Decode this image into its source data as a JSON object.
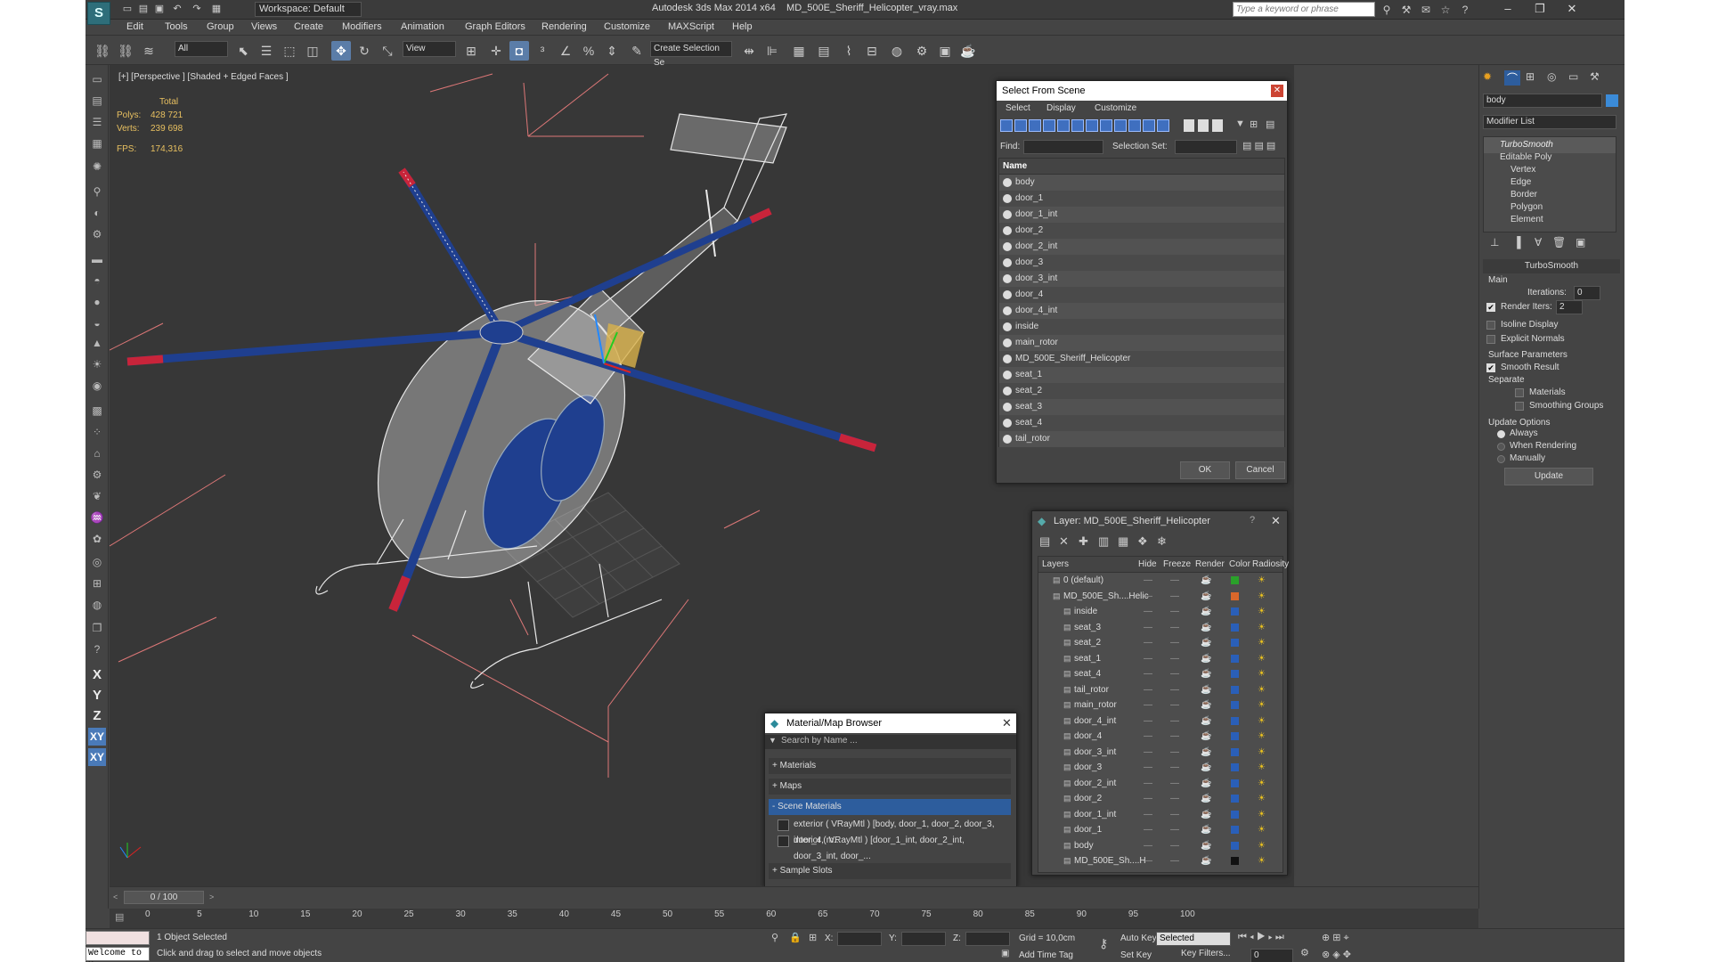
{
  "titlebar": {
    "workspace": "Workspace: Default",
    "app_title": "Autodesk 3ds Max  2014 x64",
    "file_title": "MD_500E_Sheriff_Helicopter_vray.max",
    "search_placeholder": "Type a keyword or phrase"
  },
  "menu": [
    "Edit",
    "Tools",
    "Group",
    "Views",
    "Create",
    "Modifiers",
    "Animation",
    "Graph Editors",
    "Rendering",
    "Customize",
    "MAXScript",
    "Help"
  ],
  "toolbar": {
    "selection_filter": "All",
    "ref_coord": "View",
    "named_selection": "Create Selection Se"
  },
  "viewport": {
    "label": "[+] [Perspective ] [Shaded + Edged Faces ]",
    "stats_total": "Total",
    "polys_label": "Polys:",
    "polys_value": "428 721",
    "verts_label": "Verts:",
    "verts_value": "239 698",
    "fps_label": "FPS:",
    "fps_value": "174,316"
  },
  "select_from_scene": {
    "title": "Select From Scene",
    "menu": [
      "Select",
      "Display",
      "Customize"
    ],
    "find_label": "Find:",
    "selection_set_label": "Selection Set:",
    "column_name": "Name",
    "items": [
      "body",
      "door_1",
      "door_1_int",
      "door_2",
      "door_2_int",
      "door_3",
      "door_3_int",
      "door_4",
      "door_4_int",
      "inside",
      "main_rotor",
      "MD_500E_Sheriff_Helicopter",
      "seat_1",
      "seat_2",
      "seat_3",
      "seat_4",
      "tail_rotor"
    ],
    "ok": "OK",
    "cancel": "Cancel"
  },
  "layer_dialog": {
    "title": "Layer: MD_500E_Sheriff_Helicopter",
    "columns": [
      "Layers",
      "Hide",
      "Freeze",
      "Render",
      "Color",
      "Radiosity"
    ],
    "layers": [
      {
        "name": "0 (default)",
        "indent": 0,
        "color": "#2aa12a"
      },
      {
        "name": "MD_500E_Sh....Helic",
        "indent": 0,
        "color": "#d9672a"
      },
      {
        "name": "inside",
        "indent": 1,
        "color": "#2a5fb8"
      },
      {
        "name": "seat_3",
        "indent": 1,
        "color": "#2a5fb8"
      },
      {
        "name": "seat_2",
        "indent": 1,
        "color": "#2a5fb8"
      },
      {
        "name": "seat_1",
        "indent": 1,
        "color": "#2a5fb8"
      },
      {
        "name": "seat_4",
        "indent": 1,
        "color": "#2a5fb8"
      },
      {
        "name": "tail_rotor",
        "indent": 1,
        "color": "#2a5fb8"
      },
      {
        "name": "main_rotor",
        "indent": 1,
        "color": "#2a5fb8"
      },
      {
        "name": "door_4_int",
        "indent": 1,
        "color": "#2a5fb8"
      },
      {
        "name": "door_4",
        "indent": 1,
        "color": "#2a5fb8"
      },
      {
        "name": "door_3_int",
        "indent": 1,
        "color": "#2a5fb8"
      },
      {
        "name": "door_3",
        "indent": 1,
        "color": "#2a5fb8"
      },
      {
        "name": "door_2_int",
        "indent": 1,
        "color": "#2a5fb8"
      },
      {
        "name": "door_2",
        "indent": 1,
        "color": "#2a5fb8"
      },
      {
        "name": "door_1_int",
        "indent": 1,
        "color": "#2a5fb8"
      },
      {
        "name": "door_1",
        "indent": 1,
        "color": "#2a5fb8"
      },
      {
        "name": "body",
        "indent": 1,
        "color": "#2a5fb8"
      },
      {
        "name": "MD_500E_Sh....H",
        "indent": 1,
        "color": "#111111"
      }
    ]
  },
  "material_browser": {
    "title": "Material/Map Browser",
    "search_placeholder": "Search by Name ...",
    "sections": [
      "+ Materials",
      "+ Maps",
      "- Scene Materials",
      "+ Sample Slots"
    ],
    "scene_materials": [
      "exterior  ( VRayMtl ) [body, door_1, door_2, door_3, door_4, m...",
      "interior  ( VRayMtl ) [door_1_int, door_2_int, door_3_int, door_..."
    ]
  },
  "command_panel": {
    "object_name": "body",
    "modifier_list": "Modifier List",
    "stack": [
      "TurboSmooth",
      "Editable Poly",
      "Vertex",
      "Edge",
      "Border",
      "Polygon",
      "Element"
    ],
    "rollout_title": "TurboSmooth",
    "main_label": "Main",
    "iterations_label": "Iterations:",
    "iterations_value": "0",
    "render_iters_label": "Render Iters:",
    "render_iters_value": "2",
    "isoline": "Isoline Display",
    "explicit": "Explicit Normals",
    "surface_params": "Surface Parameters",
    "smooth_result": "Smooth Result",
    "separate": "Separate",
    "materials": "Materials",
    "smoothing_groups": "Smoothing Groups",
    "update_options": "Update Options",
    "always": "Always",
    "when_rendering": "When Rendering",
    "manually": "Manually",
    "update_btn": "Update"
  },
  "timeline": {
    "frame": "0 / 100",
    "ticks": [
      "0",
      "5",
      "10",
      "15",
      "20",
      "25",
      "30",
      "35",
      "40",
      "45",
      "50",
      "55",
      "60",
      "65",
      "70",
      "75",
      "80",
      "85",
      "90",
      "95",
      "100"
    ]
  },
  "status": {
    "maxscript": "Welcome to M",
    "selected": "1 Object Selected",
    "prompt": "Click and drag to select and move objects",
    "x_label": "X:",
    "y_label": "Y:",
    "z_label": "Z:",
    "grid": "Grid = 10,0cm",
    "add_time_tag": "Add Time Tag",
    "auto_key": "Auto Key",
    "set_key": "Set Key",
    "key_mode": "Selected",
    "key_filters": "Key Filters...",
    "frame_value": "0"
  }
}
